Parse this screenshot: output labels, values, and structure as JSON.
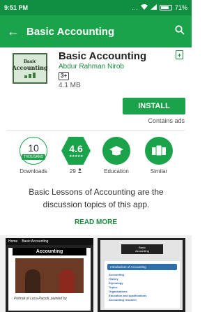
{
  "status_bar": {
    "time": "9:51 PM",
    "icons": "... ",
    "battery": "71%"
  },
  "app_bar": {
    "back_icon": "arrow-back-icon",
    "title": "Basic Accounting",
    "search_icon": "search-icon"
  },
  "app": {
    "icon_text_line1": "Basic",
    "icon_text_line2": "Accounting",
    "name": "Basic Accounting",
    "developer": "Abdur Rahman Nirob",
    "content_rating": "3+",
    "size": "4.1 MB",
    "install_label": "INSTALL",
    "contains_ads": "Contains ads"
  },
  "stats": {
    "downloads": {
      "value": "10",
      "unit": "THOUSAND",
      "caption": "Downloads"
    },
    "rating": {
      "value": "4.6",
      "stars": "★★★★★",
      "caption": "29",
      "caption_icon": "person-icon"
    },
    "category": {
      "caption": "Education",
      "icon": "graduation-cap-icon"
    },
    "similar": {
      "caption": "Similar",
      "icon": "cards-icon"
    }
  },
  "description": {
    "text": "Basic Lessons of Accounting are the discussion topics of this app.",
    "read_more": "READ MORE"
  },
  "screenshots": {
    "shot1": {
      "nav_home": "Home",
      "nav_title": "Basic Accounting",
      "heading": "Accounting",
      "caption": "Portrait of Luca Pacioli, painted by"
    },
    "shot2": {
      "header_line1": "Basic",
      "header_line2": "Accounting",
      "menu_head": "Introduction of Accounting",
      "items": [
        "Accounting",
        "History",
        "Etymology",
        "Topics",
        "Organizations",
        "Education and qualifications",
        "Accounting research"
      ]
    }
  },
  "colors": {
    "primary": "#1aa34a",
    "status_bar": "#0f8f3f",
    "accent_text": "#1a8a3e"
  }
}
